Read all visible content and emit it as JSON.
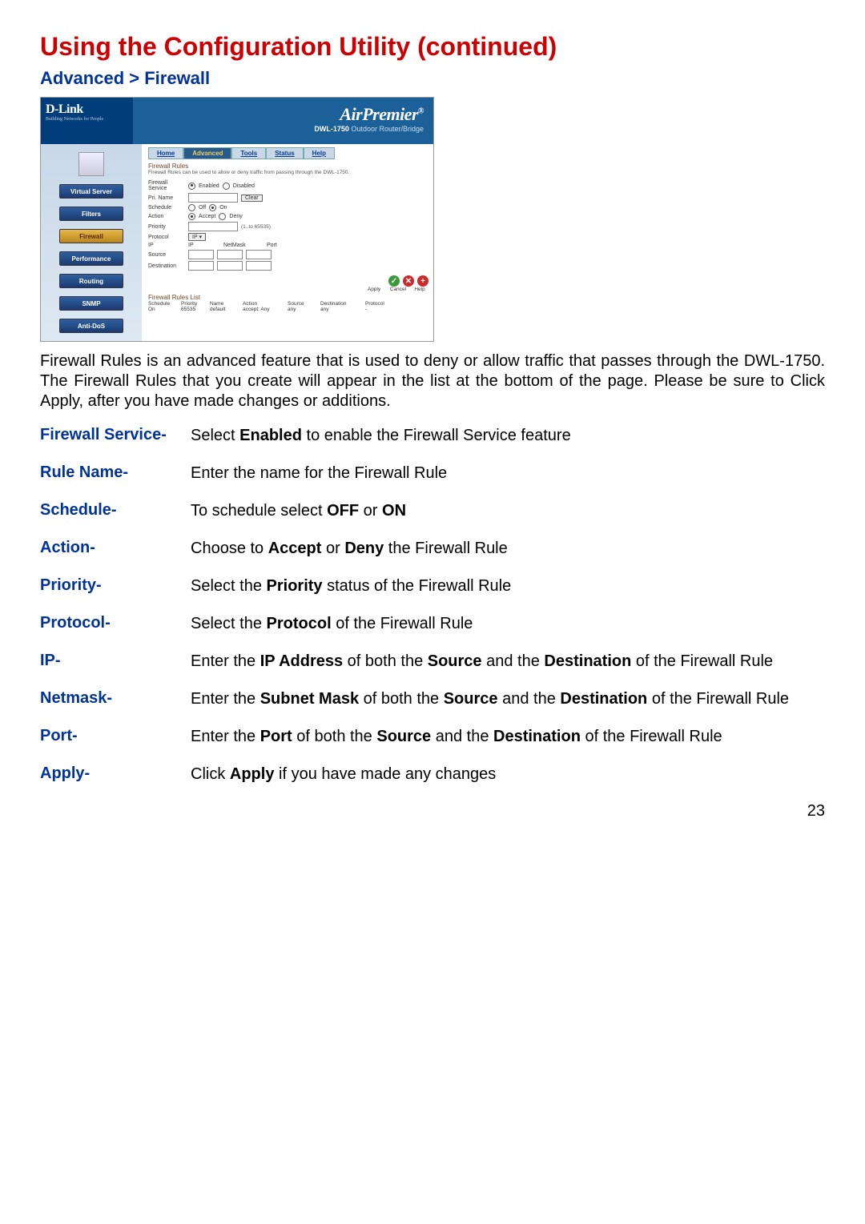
{
  "page": {
    "title": "Using the Configuration Utility (continued)",
    "breadcrumb": "Advanced > Firewall",
    "page_number": "23"
  },
  "screenshot": {
    "brand": "D-Link",
    "brand_sub": "Building Networks for People",
    "product": "AirPremier",
    "product_sub_model": "DWL-1750",
    "product_sub_desc": "Outdoor Router/Bridge",
    "tabs": [
      "Home",
      "Advanced",
      "Tools",
      "Status",
      "Help"
    ],
    "active_tab": "Advanced",
    "sidebar": [
      "Virtual Server",
      "Filters",
      "Firewall",
      "Performance",
      "Routing",
      "SNMP",
      "Anti-DoS"
    ],
    "active_sidebar": "Firewall",
    "section": "Firewall Rules",
    "hint": "Firewall Rules can be used to allow or deny traffic from passing through the DWL-1750.",
    "labels": {
      "fw_service": "Firewall Service",
      "enabled": "Enabled",
      "disabled": "Disabled",
      "pri_name": "Pri.  Name",
      "clear": "Clear",
      "schedule": "Schedule",
      "off": "Off",
      "on": "On",
      "action": "Action",
      "accept": "Accept",
      "deny": "Deny",
      "priority": "Priority",
      "pri_hint": "(1..to  65535)",
      "protocol": "Protocol",
      "proto_val": "IP",
      "ip": "IP",
      "netmask": "NetMask",
      "port": "Port",
      "src": "Source",
      "dst": "Destination"
    },
    "icon_labels": [
      "Apply",
      "Cancel",
      "Help"
    ],
    "list_title": "Firewall Rules List",
    "list_headers": [
      "Schedule",
      "Priority",
      "Name",
      "Action",
      "Source",
      "Destination",
      "Protocol"
    ],
    "list_row": [
      "On",
      "65535",
      "default",
      "accept: Any",
      "any",
      "any",
      "-"
    ]
  },
  "body_paragraph": "Firewall Rules is an advanced feature that is used to deny or allow  traffic that passes through the DWL-1750. The Firewall Rules that you create will appear in the list at the bottom of the page. Please be sure to Click Apply, after you have made changes or additions.",
  "fields": [
    {
      "label": "Firewall Service-",
      "desc": "Select <b>Enabled</b> to enable the Firewall Service feature"
    },
    {
      "label": "Rule Name-",
      "desc": "Enter the name for the Firewall Rule"
    },
    {
      "label": "Schedule-",
      "desc": "To schedule select <b>OFF</b> or <b>ON</b>"
    },
    {
      "label": "Action-",
      "desc": "Choose to <b>Accept</b> or <b>Deny</b>  the Firewall Rule"
    },
    {
      "label": "Priority-",
      "desc": "Select the <b>Priority</b> status of the Firewall Rule"
    },
    {
      "label": "Protocol-",
      "desc": "Select the <b>Protocol</b> of the Firewall Rule"
    },
    {
      "label": "IP-",
      "desc": "Enter the <b>IP Address</b> of both the <b>Source</b> and the <b>Destination</b> of the Firewall Rule"
    },
    {
      "label": "Netmask-",
      "desc": "Enter the <b>Subnet Mask</b> of both the <b>Source</b> and the <b>Destination</b> of the Firewall Rule"
    },
    {
      "label": "Port-",
      "desc": "Enter the <b>Port</b> of both the <b>Source</b> and the <b>Destination</b> of the Firewall Rule"
    },
    {
      "label": "Apply-",
      "desc": "Click <b>Apply</b> if you have made any changes"
    }
  ]
}
